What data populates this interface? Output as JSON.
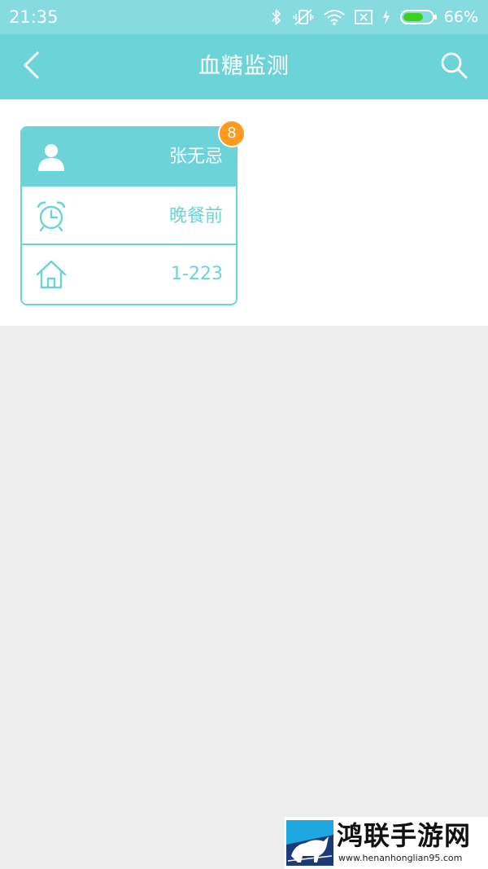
{
  "status_bar": {
    "time": "21:35",
    "battery": "66%",
    "icons": [
      "bluetooth-icon",
      "vibrate-off-icon",
      "wifi-icon",
      "sim-x-icon",
      "charging-icon",
      "battery-icon"
    ]
  },
  "header": {
    "title": "血糖监测",
    "back_icon": "chevron-left-icon",
    "search_icon": "search-icon"
  },
  "patient_card": {
    "badge": "8",
    "name": "张无忌",
    "meal": "晚餐前",
    "room": "1-223",
    "icons": [
      "user-icon",
      "alarm-clock-icon",
      "home-icon"
    ]
  },
  "watermark": {
    "title": "鸿联手游网",
    "url": "www.henanhonglian95.com"
  },
  "colors": {
    "status_bar": "#86dbe0",
    "accent": "#6cd3d8",
    "badge": "#ff9a1f",
    "background": "#eeeeee"
  }
}
